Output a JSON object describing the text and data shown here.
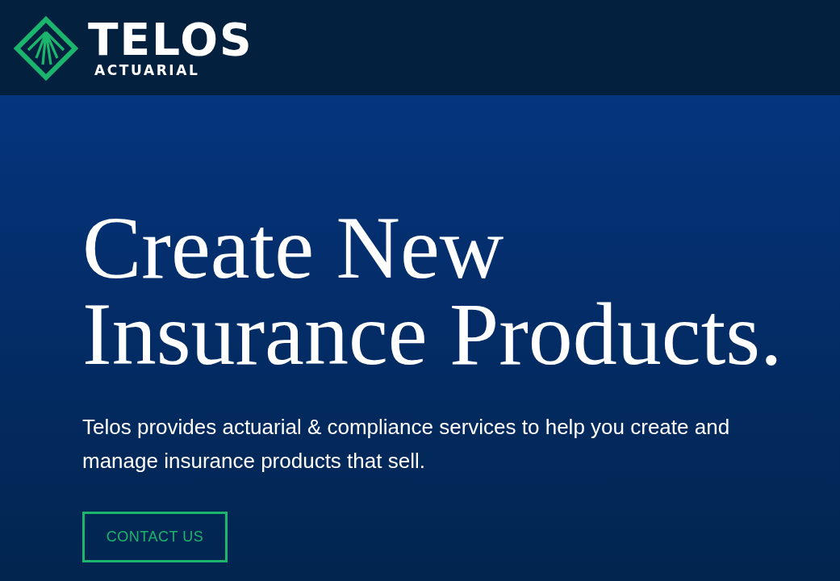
{
  "header": {
    "logo": {
      "name": "TELOS",
      "subtitle": "ACTUARIAL"
    }
  },
  "hero": {
    "headline": "Create New Insurance Products.",
    "description": "Telos provides actuarial & compliance services to help you create and manage insurance products that sell.",
    "cta": {
      "label": "CONTACT US"
    }
  }
}
